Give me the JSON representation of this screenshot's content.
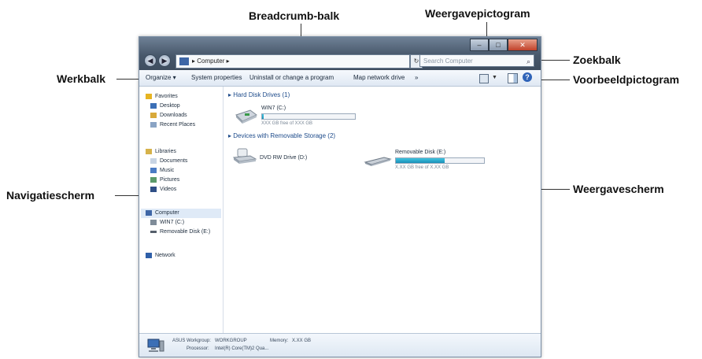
{
  "callouts": {
    "breadcrumb": "Breadcrumb-balk",
    "view_icon": "Weergavepictogram",
    "search": "Zoekbalk",
    "toolbar": "Werkbalk",
    "preview_icon": "Voorbeeldpictogram",
    "navigation": "Navigatiescherm",
    "view_pane": "Weergavescherm"
  },
  "window": {
    "address": "▸ Computer ▸",
    "search_placeholder": "Search Computer",
    "toolbar": {
      "organize": "Organize ▾",
      "system_properties": "System properties",
      "uninstall": "Uninstall or change a program",
      "map_drive": "Map network drive",
      "more": "»"
    },
    "nav": {
      "favorites": "Favorites",
      "desktop": "Desktop",
      "downloads": "Downloads",
      "recent": "Recent Places",
      "libraries": "Libraries",
      "documents": "Documents",
      "music": "Music",
      "pictures": "Pictures",
      "videos": "Videos",
      "computer": "Computer",
      "win7": "WIN7 (C:)",
      "removable": "Removable Disk (E:)",
      "network": "Network"
    },
    "content": {
      "hdd_group": "Hard Disk Drives (1)",
      "win7_name": "WIN7 (C:)",
      "win7_free": "XXX GB free of XXX GB",
      "win7_used_fraction": 0.02,
      "removable_group": "Devices with Removable Storage (2)",
      "dvd_name": "DVD RW Drive (D:)",
      "usb_name": "Removable Disk (E:)",
      "usb_free": "X.XX GB free of X.XX GB",
      "usb_used_fraction": 0.55
    },
    "status": {
      "pc_name": "ASUS",
      "workgroup_label": "Workgroup:",
      "workgroup_value": "WORKGROUP",
      "memory_label": "Memory:",
      "memory_value": "X.XX GB",
      "processor_label": "Processor:",
      "processor_value": "Intel(R) Core(TM)2 Qua..."
    }
  },
  "colors": {
    "accent": "#2f63b8",
    "progress": "#1a90b8"
  }
}
